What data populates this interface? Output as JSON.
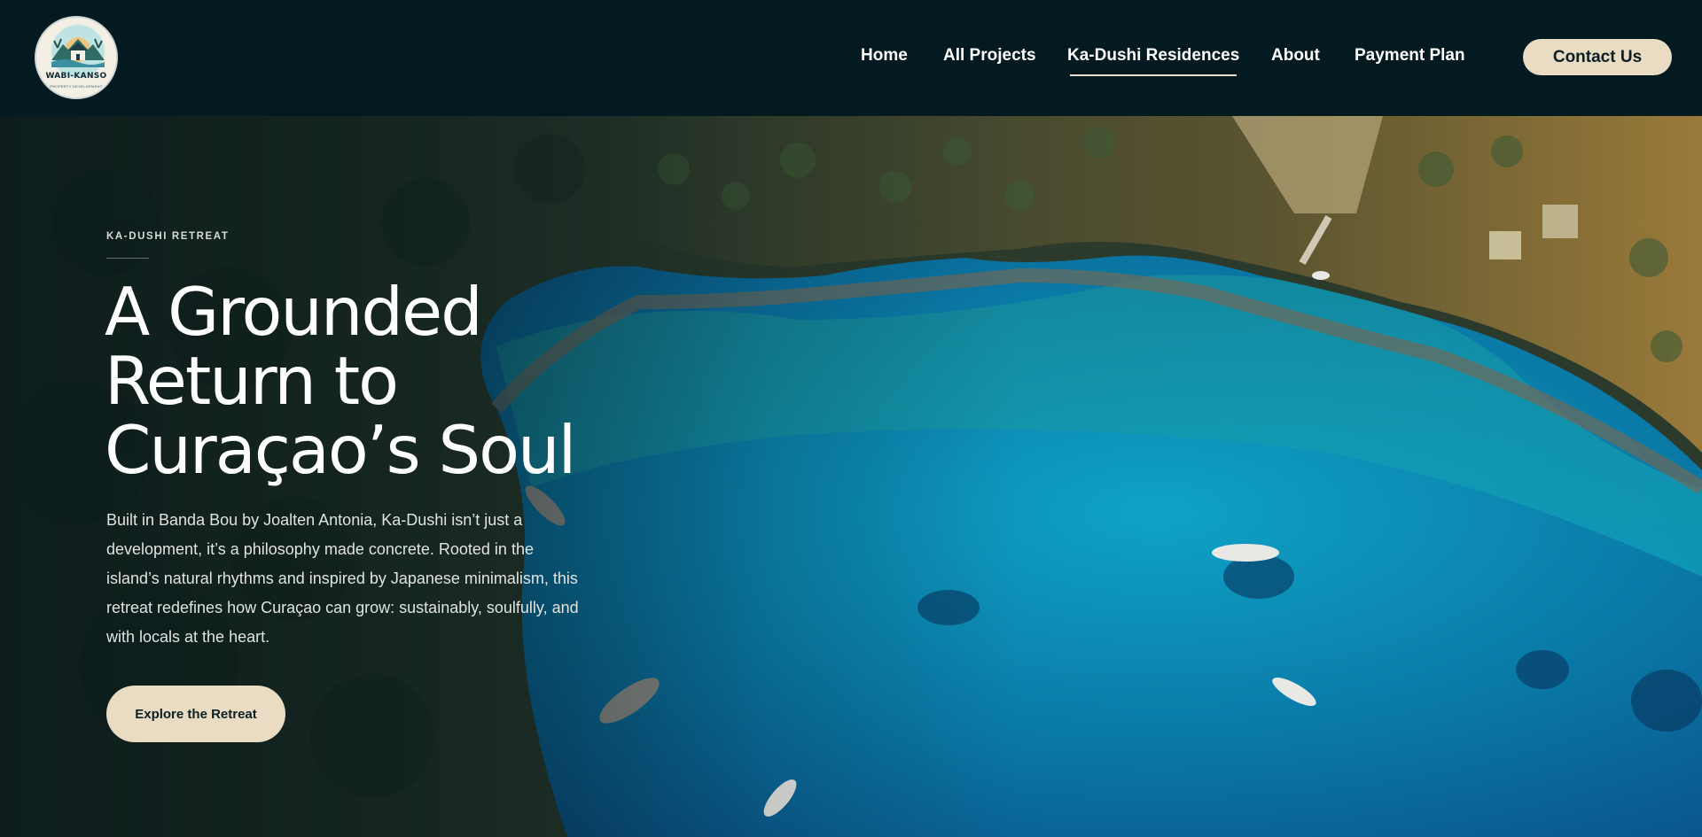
{
  "header": {
    "logo": {
      "name": "WABI-KANSO",
      "tagline": "PROPERTY DEVELOPMENT"
    },
    "nav": [
      {
        "label": "Home"
      },
      {
        "label": "All Projects"
      },
      {
        "label": "Ka-Dushi Residences",
        "active": true
      },
      {
        "label": "About"
      },
      {
        "label": "Payment Plan"
      }
    ],
    "contact_label": "Contact Us"
  },
  "hero": {
    "eyebrow": "KA-DUSHI RETREAT",
    "headline": [
      "A Grounded",
      "Return to",
      "Curaçao’s Soul"
    ],
    "body": "Built in Banda Bou by Joalten Antonia, Ka-Dushi isn’t just a development, it’s a philosophy made concrete. Rooted in the island’s natural rhythms and inspired by Japanese minimalism, this retreat redefines how Curaçao can grow: sustainably, soulfully, and with locals at the heart.",
    "cta_label": "Explore the Retreat"
  },
  "colors": {
    "header_bg": "#031a20",
    "accent": "#e9dcc3",
    "text": "#ffffff"
  }
}
